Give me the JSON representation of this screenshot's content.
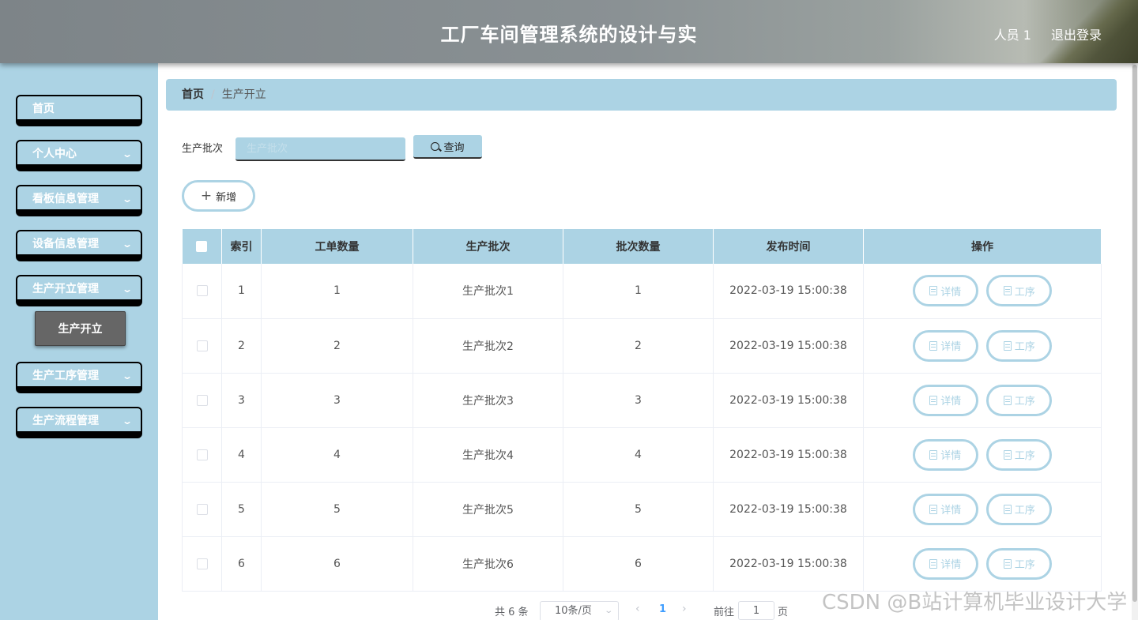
{
  "header": {
    "title": "工厂车间管理系统的设计与实",
    "user": "人员 1",
    "logout": "退出登录"
  },
  "sidebar": {
    "items": [
      {
        "label": "首页",
        "has_children": false
      },
      {
        "label": "个人中心",
        "has_children": true
      },
      {
        "label": "看板信息管理",
        "has_children": true
      },
      {
        "label": "设备信息管理",
        "has_children": true
      },
      {
        "label": "生产开立管理",
        "has_children": true
      },
      {
        "label": "生产工序管理",
        "has_children": true
      },
      {
        "label": "生产流程管理",
        "has_children": true
      }
    ],
    "active_sub": "生产开立"
  },
  "breadcrumb": {
    "home": "首页",
    "separator": "/",
    "current": "生产开立"
  },
  "search": {
    "label": "生产批次",
    "placeholder": "生产批次",
    "value": "",
    "button": "查询"
  },
  "toolbar": {
    "add": "新增"
  },
  "table": {
    "columns": [
      "索引",
      "工单数量",
      "生产批次",
      "批次数量",
      "发布时间",
      "操作"
    ],
    "rows": [
      {
        "index": "1",
        "orders": "1",
        "batch": "生产批次1",
        "batch_qty": "1",
        "time": "2022-03-19 15:00:38"
      },
      {
        "index": "2",
        "orders": "2",
        "batch": "生产批次2",
        "batch_qty": "2",
        "time": "2022-03-19 15:00:38"
      },
      {
        "index": "3",
        "orders": "3",
        "batch": "生产批次3",
        "batch_qty": "3",
        "time": "2022-03-19 15:00:38"
      },
      {
        "index": "4",
        "orders": "4",
        "batch": "生产批次4",
        "batch_qty": "4",
        "time": "2022-03-19 15:00:38"
      },
      {
        "index": "5",
        "orders": "5",
        "batch": "生产批次5",
        "batch_qty": "5",
        "time": "2022-03-19 15:00:38"
      },
      {
        "index": "6",
        "orders": "6",
        "batch": "生产批次6",
        "batch_qty": "6",
        "time": "2022-03-19 15:00:38"
      }
    ],
    "actions": {
      "detail": "详情",
      "process": "工序"
    }
  },
  "pagination": {
    "total": "共 6 条",
    "page_size": "10条/页",
    "current_page": "1",
    "goto": "前往",
    "jump_value": "1",
    "page_unit": "页"
  },
  "watermark": "CSDN @B站计算机毕业设计大学",
  "colors": {
    "accent": "#acd3e4",
    "header": "#848b8e",
    "submenu_active": "#666666"
  }
}
